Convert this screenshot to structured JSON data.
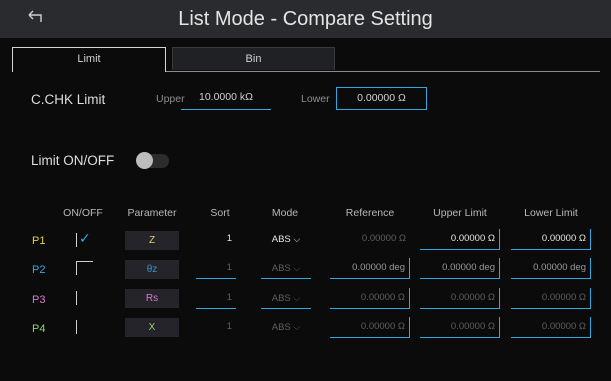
{
  "header": {
    "title": "List Mode - Compare Setting",
    "back_icon": "back-icon"
  },
  "tabs": [
    {
      "label": "Limit",
      "active": true
    },
    {
      "label": "Bin",
      "active": false
    }
  ],
  "cchk": {
    "label": "C.CHK Limit",
    "upper_label": "Upper",
    "upper_value": "10.0000 kΩ",
    "lower_label": "Lower",
    "lower_value": "0.00000 Ω"
  },
  "limit_toggle": {
    "label": "Limit ON/OFF",
    "state": "off"
  },
  "table": {
    "columns": [
      "ON/OFF",
      "Parameter",
      "Sort",
      "Mode",
      "Reference",
      "Upper Limit",
      "Lower Limit"
    ],
    "rows": [
      {
        "name": "P1",
        "color": "#e8d23a",
        "checked": true,
        "parameter": "Z",
        "param_color": "#d8d36a",
        "sort": "1",
        "mode": "ABS",
        "reference": "0.00000 Ω",
        "upper": "0.00000 Ω",
        "lower": "0.00000 Ω"
      },
      {
        "name": "P2",
        "color": "#2fa8dd",
        "checked": false,
        "parameter": "θz",
        "param_color": "#3d8fc8",
        "sort": "1",
        "mode": "ABS",
        "reference": "0.00000 deg",
        "upper": "0.00000 deg",
        "lower": "0.00000 deg"
      },
      {
        "name": "P3",
        "color": "#d77ad3",
        "checked": false,
        "parameter": "Rs",
        "param_color": "#d77ad3",
        "sort": "1",
        "mode": "ABS",
        "reference": "0.00000 Ω",
        "upper": "0.00000 Ω",
        "lower": "0.00000 Ω"
      },
      {
        "name": "P4",
        "color": "#8fd46a",
        "checked": false,
        "parameter": "X",
        "param_color": "#8fd46a",
        "sort": "1",
        "mode": "ABS",
        "reference": "0.00000 Ω",
        "upper": "0.00000 Ω",
        "lower": "0.00000 Ω"
      }
    ]
  },
  "colors": {
    "accent": "#2fa8dd",
    "background": "#0b0b0c",
    "titlebar": "#2a2b2e"
  },
  "icons": {
    "back": "back-arrow-icon",
    "check": "check-icon",
    "dropdown": "chevron-down-icon"
  }
}
